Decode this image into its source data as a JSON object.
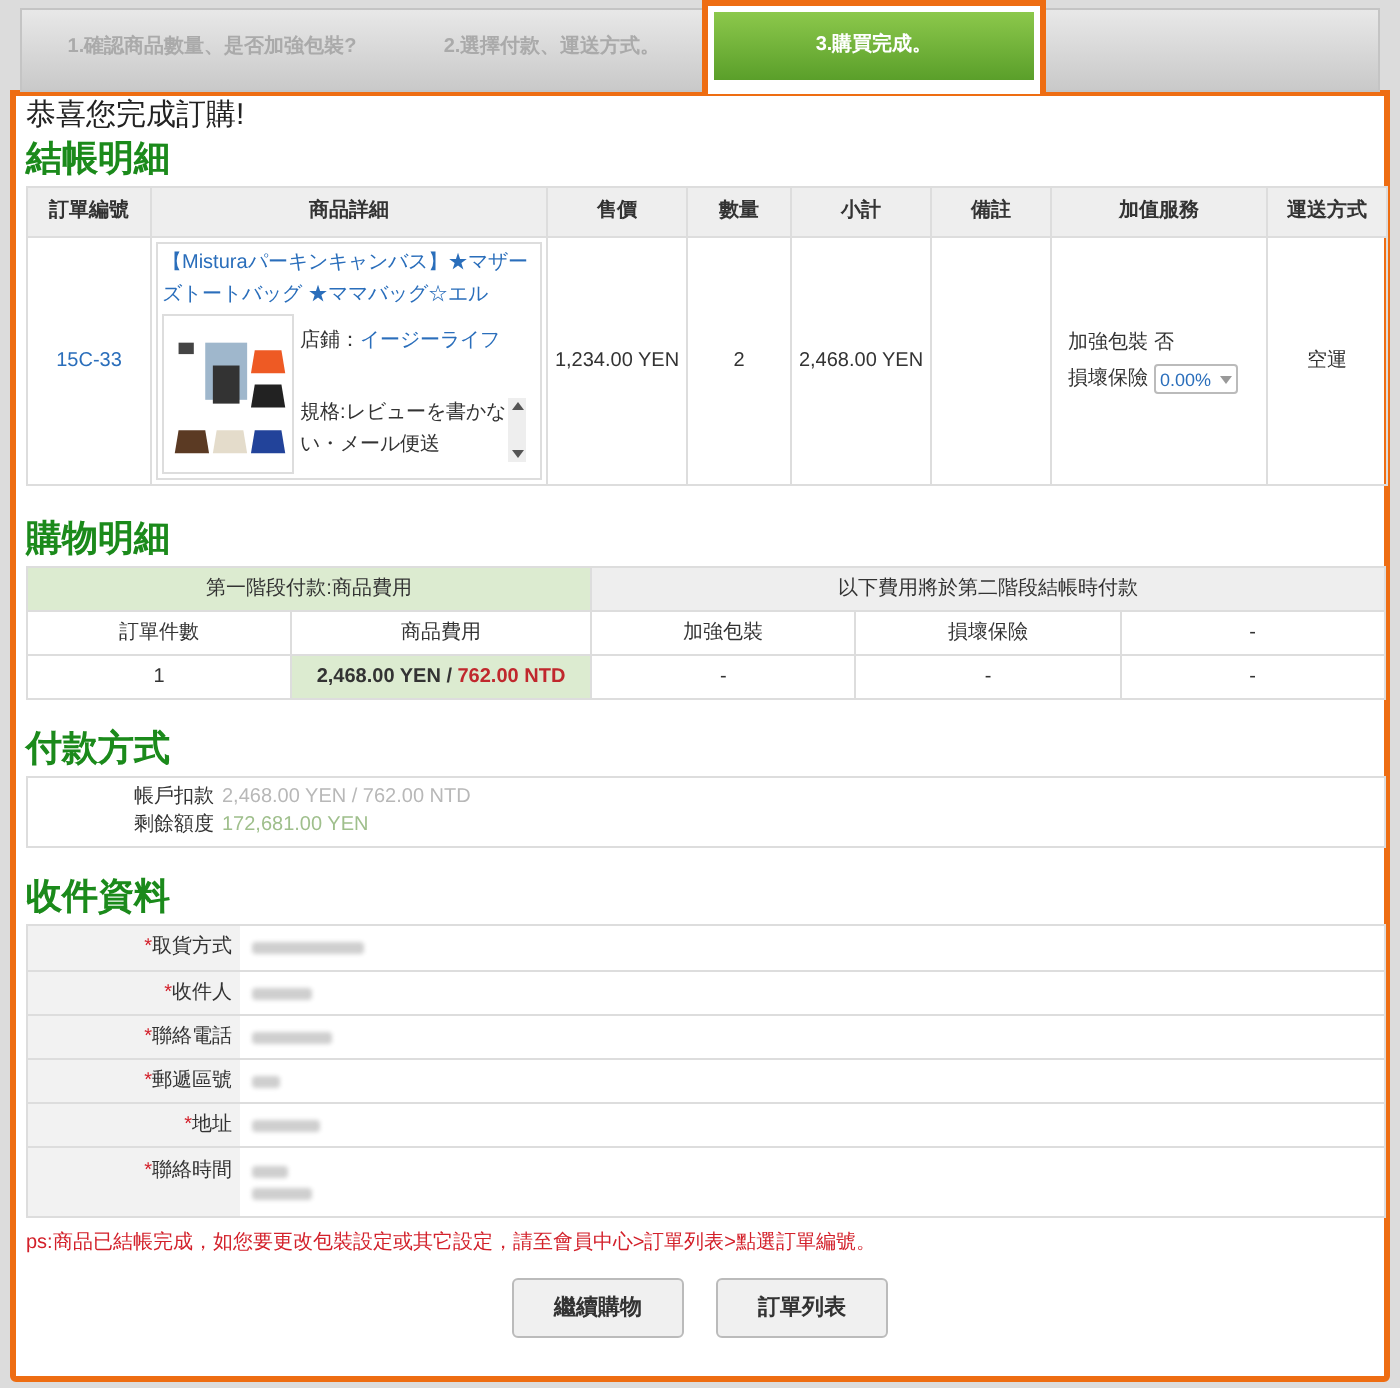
{
  "steps": [
    {
      "label": "1.確認商品數量、是否加強包裝?",
      "selected": false
    },
    {
      "label": "2.選擇付款、運送方式。",
      "selected": false
    },
    {
      "label": "3.購買完成。",
      "selected": true
    }
  ],
  "greeting": "恭喜您完成訂購!",
  "checkout": {
    "title": "結帳明細",
    "columns": [
      "訂單編號",
      "商品詳細",
      "售價",
      "數量",
      "小計",
      "備註",
      "加值服務",
      "運送方式"
    ],
    "rows": [
      {
        "order_no": "15C-33",
        "product_title": "【Misturaパーキンキャンバス】★マザーズトートバッグ ★ママバッグ☆エル",
        "shop_label": "店鋪：",
        "shop_name": "イージーライフ",
        "spec": "規格:レビューを書かない・メール便送",
        "price": "1,234.00 YEN",
        "quantity": "2",
        "subtotal": "2,468.00 YEN",
        "note": "",
        "services": [
          {
            "kind": "text",
            "label": "加強包裝",
            "value": "否"
          },
          {
            "kind": "select",
            "label": "損壞保險",
            "value": "0.00%"
          }
        ],
        "shipping": "空運"
      }
    ]
  },
  "shopping": {
    "title": "購物明細",
    "stage1": "第一階段付款:商品費用",
    "stage2": "以下費用將於第二階段結帳時付款",
    "columns": [
      "訂單件數",
      "商品費用",
      "加強包裝",
      "損壞保險",
      "-"
    ],
    "count": "1",
    "amount": "2,468.00 YEN / ",
    "converted": "762.00 NTD",
    "cells": [
      "-",
      "-",
      "-"
    ]
  },
  "payment": {
    "title": "付款方式",
    "rows": [
      {
        "kind": "debit",
        "label": "帳戶扣款",
        "value": "2,468.00 YEN / 762.00 NTD"
      },
      {
        "kind": "balance",
        "label": "剩餘額度",
        "value": "172,681.00 YEN"
      }
    ]
  },
  "recipient": {
    "title": "收件資料",
    "rows": [
      {
        "kind": "single",
        "mark": "*",
        "label": "取貨方式"
      },
      {
        "kind": "single",
        "mark": "*",
        "label": "收件人"
      },
      {
        "kind": "single",
        "mark": "*",
        "label": "聯絡電話"
      },
      {
        "kind": "single",
        "mark": "*",
        "label": "郵遞區號"
      },
      {
        "kind": "single",
        "mark": "*",
        "label": "地址"
      },
      {
        "kind": "double",
        "mark": "*",
        "label": "聯絡時間"
      }
    ]
  },
  "notice": "ps:商品已結帳完成，如您要更改包裝設定或其它設定，請至會員中心>訂單列表>點選訂單編號。",
  "buttons": [
    "繼續購物",
    "訂單列表"
  ]
}
